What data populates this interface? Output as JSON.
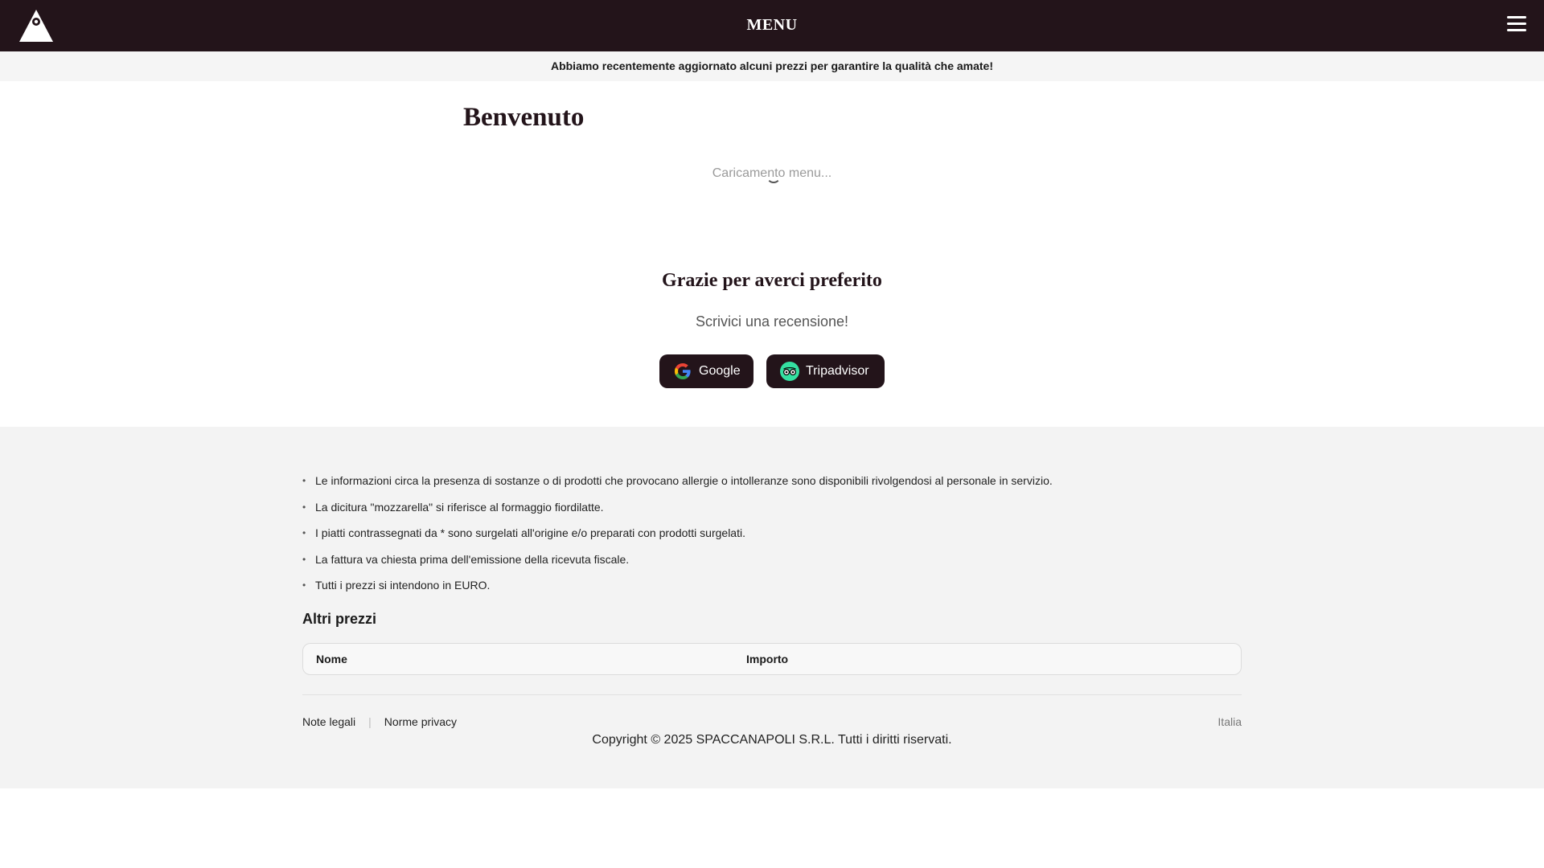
{
  "header": {
    "title": "MENU"
  },
  "notice": {
    "text": "Abbiamo recentemente aggiornato alcuni prezzi per garantire la qualità che amate!"
  },
  "main": {
    "welcome": "Benvenuto",
    "loading": "Caricamento menu..."
  },
  "review": {
    "title": "Grazie per averci preferito",
    "subtitle": "Scrivici una recensione!",
    "buttons": [
      {
        "label": "Google",
        "icon": "google-icon"
      },
      {
        "label": "Tripadvisor",
        "icon": "tripadvisor-icon"
      }
    ]
  },
  "info": {
    "items": [
      "Le informazioni circa la presenza di sostanze o di prodotti che provocano allergie o intolleranze sono disponibili rivolgendosi al personale in servizio.",
      "La dicitura \"mozzarella\" si riferisce al formaggio fiordilatte.",
      "I piatti contrassegnati da * sono surgelati all'origine e/o preparati con prodotti surgelati.",
      "La fattura va chiesta prima dell'emissione della ricevuta fiscale.",
      "Tutti i prezzi si intendono in EURO."
    ]
  },
  "altri_prezzi": {
    "title": "Altri prezzi",
    "columns": [
      "Nome",
      "Importo"
    ]
  },
  "footer": {
    "links": [
      "Note legali",
      "Norme privacy"
    ],
    "separator": "|",
    "country": "Italia",
    "copyright": "Copyright © 2025 SPACCANAPOLI S.R.L. Tutti i diritti riservati."
  },
  "colors": {
    "brand_dark": "#23141a",
    "tripadvisor_green": "#34e0a1"
  }
}
